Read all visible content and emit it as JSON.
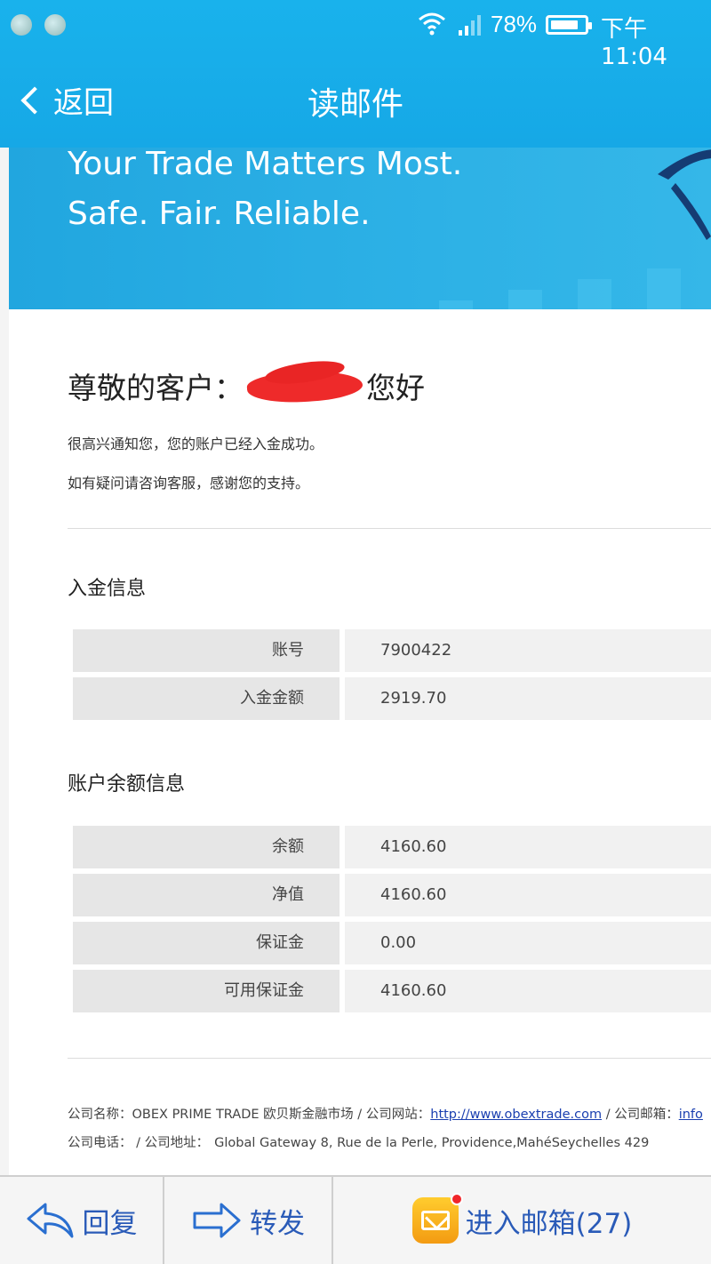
{
  "status_bar": {
    "battery_percent": "78%",
    "time": "下午11:04"
  },
  "nav": {
    "back_label": "返回",
    "title": "读邮件"
  },
  "banner": {
    "line1": "Your Trade Matters Most.",
    "line2": "Safe. Fair. Reliable."
  },
  "email": {
    "greeting_prefix": "尊敬的客户：",
    "greeting_suffix": "您好",
    "intro_1": "很高兴通知您，您的账户已经入金成功。",
    "intro_2": "如有疑问请咨询客服，感谢您的支持。",
    "deposit_section_title": "入金信息",
    "deposit_rows": [
      {
        "label": "账号",
        "value": "7900422"
      },
      {
        "label": "入金金额",
        "value": "2919.70"
      }
    ],
    "balance_section_title": "账户余额信息",
    "balance_rows": [
      {
        "label": "余额",
        "value": "4160.60"
      },
      {
        "label": "净值",
        "value": "4160.60"
      },
      {
        "label": "保证金",
        "value": "0.00"
      },
      {
        "label": "可用保证金",
        "value": "4160.60"
      }
    ],
    "footer": {
      "company_name_label": "公司名称：",
      "company_name": "OBEX PRIME TRADE 欧贝斯金融市场",
      "sep1": " / ",
      "website_label": "公司网站：",
      "website": "http://www.obextrade.com",
      "sep2": " / ",
      "email_label": "公司邮箱：",
      "email_partial": "info",
      "phone_label": "公司电话：",
      "sep3": " / ",
      "address_label": "公司地址：",
      "address": "Global Gateway 8, Rue de la Perle, Providence,MahéSeychelles 429"
    }
  },
  "toolbar": {
    "reply_label": "回复",
    "forward_label": "转发",
    "inbox_label": "进入邮箱(27)"
  },
  "colors": {
    "header_blue": "#19b2ec",
    "link_blue": "#1a3fb0",
    "toolbar_text": "#2a5bb8",
    "redaction_red": "#ee2a2a"
  }
}
